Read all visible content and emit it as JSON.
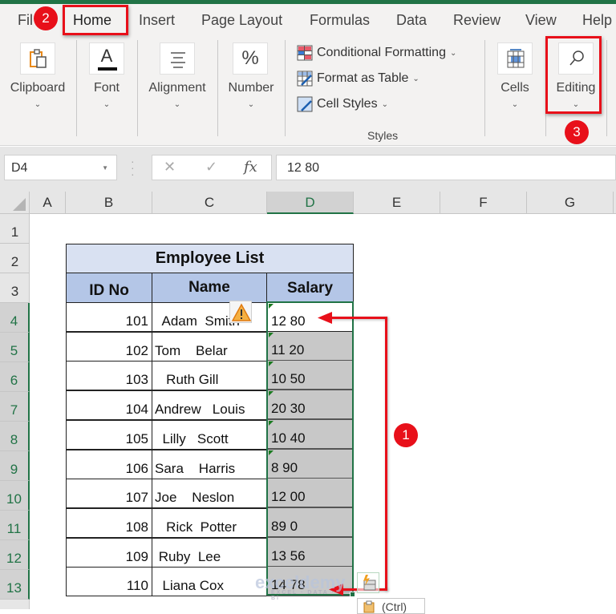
{
  "ribbon_tabs": [
    {
      "label": "File",
      "visible_text": "Fil"
    },
    {
      "label": "Home",
      "active": true
    },
    {
      "label": "Insert"
    },
    {
      "label": "Page Layout"
    },
    {
      "label": "Formulas"
    },
    {
      "label": "Data"
    },
    {
      "label": "Review"
    },
    {
      "label": "View"
    },
    {
      "label": "Help"
    }
  ],
  "ribbon_groups": {
    "clipboard": {
      "label": "Clipboard",
      "icon": "clipboard-icon"
    },
    "font": {
      "label": "Font",
      "icon": "font-color-icon",
      "glyph": "A"
    },
    "alignment": {
      "label": "Alignment",
      "icon": "align-center-icon"
    },
    "number": {
      "label": "Number",
      "icon": "percent-icon",
      "glyph": "%"
    },
    "styles": {
      "label": "Styles",
      "items": [
        {
          "label": "Conditional Formatting",
          "icon": "conditional-formatting-icon"
        },
        {
          "label": "Format as Table",
          "icon": "format-as-table-icon"
        },
        {
          "label": "Cell Styles",
          "icon": "cell-styles-icon"
        }
      ]
    },
    "cells": {
      "label": "Cells",
      "icon": "cells-icon"
    },
    "editing": {
      "label": "Editing",
      "icon": "search-icon"
    }
  },
  "chevron": "⌄",
  "annotations": {
    "step1": "1",
    "step2": "2",
    "step3": "3"
  },
  "formula_bar": {
    "name_box": "D4",
    "cancel_glyph": "✕",
    "enter_glyph": "✓",
    "fx_glyph": "fx",
    "formula": "12 80"
  },
  "columns": [
    "A",
    "B",
    "C",
    "D",
    "E",
    "F",
    "G"
  ],
  "selected_column": "D",
  "rows": [
    "1",
    "2",
    "3",
    "4",
    "5",
    "6",
    "7",
    "8",
    "9",
    "10",
    "11",
    "12",
    "13"
  ],
  "table": {
    "title": "Employee List",
    "headers": [
      "ID No",
      "Name",
      "Salary"
    ],
    "records": [
      {
        "id": "101",
        "name": "  Adam  Smith",
        "salary": "12 80"
      },
      {
        "id": "102",
        "name": "Tom    Belar",
        "salary": "11 20"
      },
      {
        "id": "103",
        "name": "   Ruth Gill",
        "salary": "10 50"
      },
      {
        "id": "104",
        "name": "Andrew   Louis",
        "salary": "20 30"
      },
      {
        "id": "105",
        "name": "  Lilly   Scott",
        "salary": "10 40"
      },
      {
        "id": "106",
        "name": "Sara    Harris",
        "salary": "8 90"
      },
      {
        "id": "107",
        "name": "Joe    Neslon",
        "salary": "12 00"
      },
      {
        "id": "108",
        "name": "   Rick  Potter",
        "salary": "89 0"
      },
      {
        "id": "109",
        "name": " Ruby  Lee",
        "salary": "13 56"
      },
      {
        "id": "110",
        "name": "  Liana Cox",
        "salary": "14 78"
      }
    ]
  },
  "watermark": {
    "brand": "exceldemy",
    "tagline": "EXCEL · DATA · BI"
  },
  "paste_options": {
    "label": "(Ctrl)"
  },
  "colors": {
    "excel_green": "#217346",
    "annotation_red": "#e8101a",
    "title_fill": "#d9e1f2",
    "header_fill": "#b4c6e7"
  }
}
